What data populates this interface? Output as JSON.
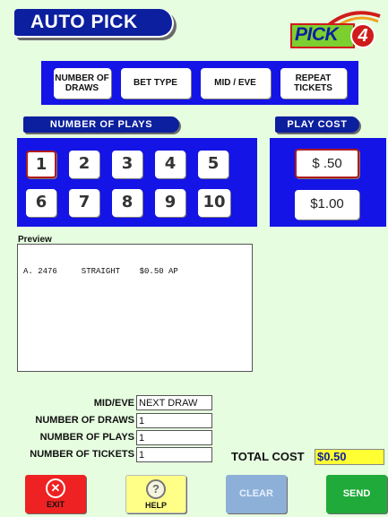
{
  "header": {
    "title": "AUTO PICK"
  },
  "logo": {
    "text": "PICK",
    "number": "4"
  },
  "options": {
    "number_of_draws": "NUMBER OF\nDRAWS",
    "bet_type": "BET TYPE",
    "mid_eve": "MID / EVE",
    "repeat_tickets": "REPEAT\nTICKETS"
  },
  "plays": {
    "title": "NUMBER OF PLAYS",
    "buttons": [
      "1",
      "2",
      "3",
      "4",
      "5",
      "6",
      "7",
      "8",
      "9",
      "10"
    ],
    "selected": "1"
  },
  "cost": {
    "title": "PLAY COST",
    "options": [
      "$ .50",
      "$1.00"
    ],
    "selected": "$ .50"
  },
  "preview": {
    "label": "Preview",
    "lines": [
      "A. 2476     STRAIGHT    $0.50 AP"
    ]
  },
  "fields": {
    "mid_eve_label": "MID/EVE",
    "mid_eve_value": "NEXT DRAW",
    "draws_label": "NUMBER OF DRAWS",
    "draws_value": "1",
    "plays_label": "NUMBER OF PLAYS",
    "plays_value": "1",
    "tickets_label": "NUMBER OF TICKETS",
    "tickets_value": "1"
  },
  "total": {
    "label": "TOTAL COST",
    "value": "$0.50"
  },
  "buttons": {
    "exit": "EXIT",
    "help": "HELP",
    "clear": "CLEAR",
    "send": "SEND"
  },
  "colors": {
    "background": "#e6fde0",
    "panel_blue": "#1414e6",
    "pill_navy": "#0c1f9e",
    "exit_red": "#ee2222",
    "help_yellow": "#ffff88",
    "clear_blue": "#8db0d8",
    "send_green": "#1faa3a",
    "total_yellow": "#ffff33"
  }
}
